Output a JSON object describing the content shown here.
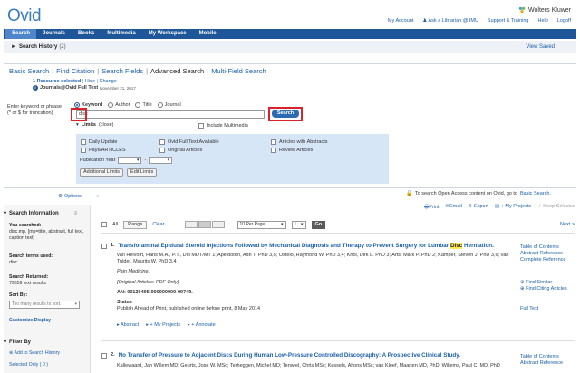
{
  "header": {
    "logo": "Ovid",
    "brand": "Wolters Kluwer",
    "links": [
      "My Account",
      "Ask a Librarian @ IMU",
      "Support & Training",
      "Help",
      "Logoff"
    ]
  },
  "nav": {
    "tabs": [
      "Search",
      "Journals",
      "Books",
      "Multimedia",
      "My Workspace",
      "Mobile"
    ],
    "active": "Search"
  },
  "history": {
    "title": "Search History",
    "count": "(2)",
    "view_saved": "View Saved"
  },
  "search": {
    "tabs": [
      "Basic Search",
      "Find Citation",
      "Search Fields",
      "Advanced Search",
      "Multi-Field Search"
    ],
    "resources_selected": "1 Resource selected",
    "hide": "Hide",
    "change": "Change",
    "resource_name": "Journals@Ovid Full Text",
    "resource_date": "November 21, 2017",
    "enter_label_1": "Enter keyword or phrase",
    "enter_label_2": "(* or $ for truncation)",
    "radios": [
      "Keyword",
      "Author",
      "Title",
      "Journal"
    ],
    "query": "disc",
    "search_button": "Search",
    "limits": "Limits",
    "limits_close": "(close)",
    "include_multimedia": "Include Multimedia",
    "limit_col1": [
      "Daily Update",
      "Pays/ARTICLES"
    ],
    "limit_col2": [
      "Ovid Full Text Available",
      "Original Articles"
    ],
    "limit_col3": [
      "Articles with Abstracts",
      "Review Articles"
    ],
    "pub_year": "Publication Year",
    "pub_sep": "-",
    "additional_limits": "Additional Limits",
    "edit_limits": "Edit Limits"
  },
  "options": "Options",
  "open_access": "To search Open Access content on Ovid, go to",
  "basic_search_link": "Basic Search.",
  "actions": [
    "Print",
    "Email",
    "Export",
    "+ My Projects",
    "Keep Selected"
  ],
  "sidebar": {
    "search_info": "Search Information",
    "you_searched": "You searched:",
    "searched_text": "disc.mp. [mp=title, abstract, full text, caption text]",
    "terms_used": "Search terms used:",
    "term": "disc",
    "returned": "Search Returned:",
    "returned_val": "79659 text results",
    "sort_by": "Sort By:",
    "sort_placeholder": "Too many results to sort.",
    "customize": "Customize Display",
    "filter_by": "Filter By",
    "add_history": "Add to Search History",
    "selected_only": "Selected Only ( 0 )"
  },
  "toolbar": {
    "all": "All",
    "range": "Range",
    "clear": "Clear",
    "per_page": "10 Per Page",
    "page": "1",
    "go": "Go",
    "next": "Next >"
  },
  "results": [
    {
      "num": "1.",
      "title_before": "Transforaminal Epidural Steroid Injections Followed by Mechanical Diagnosis and Therapy to Prevent Surgery for Lumbar ",
      "title_hl": "Disc",
      "title_after": " Herniation.",
      "authors": "van Helvoirt, Hans M.A., P.T., Dip MDT/MT 1; Apeldoorn, Adri T. PhD 3,5; Ostelo, Raymond W. PhD 3,4; Knol, Dirk L. PhD 3; Arts, Mark P. PhD 2; Kamper, Steven J. PhD 3,6; van Tulder, Maurits W. PhD 3,4",
      "journal": "Pain Medicine.",
      "type": "[Original Articles: PDF Only]",
      "an": "AN: 00130495-900000000-99749.",
      "status_label": "Status",
      "status": "Publish Ahead of Print, published online before print, 8 May 2014",
      "links": [
        "Table of Contents",
        "Abstract Reference",
        "Complete Reference",
        "Find Similar",
        "Find Citing Articles",
        "Full Text"
      ],
      "actions": [
        "Abstract",
        "My Projects",
        "Annotate"
      ]
    },
    {
      "num": "2.",
      "title": "No Transfer of Pressure to Adjacent Discs During Human Low-Pressure Controlled Discography: A Prospective Clinical Study.",
      "authors": "Kallewaard, Jan Willem MD; Geurts, Jose W. MSc; Terheggen, Michel MD; Tenwiel, Chris MSc; Kessels, Alfons MSc; van Kleef, Maarten MD, PhD; Willems, Paul C. MD, PhD",
      "links": [
        "Table of Contents",
        "Abstract Reference"
      ]
    }
  ]
}
